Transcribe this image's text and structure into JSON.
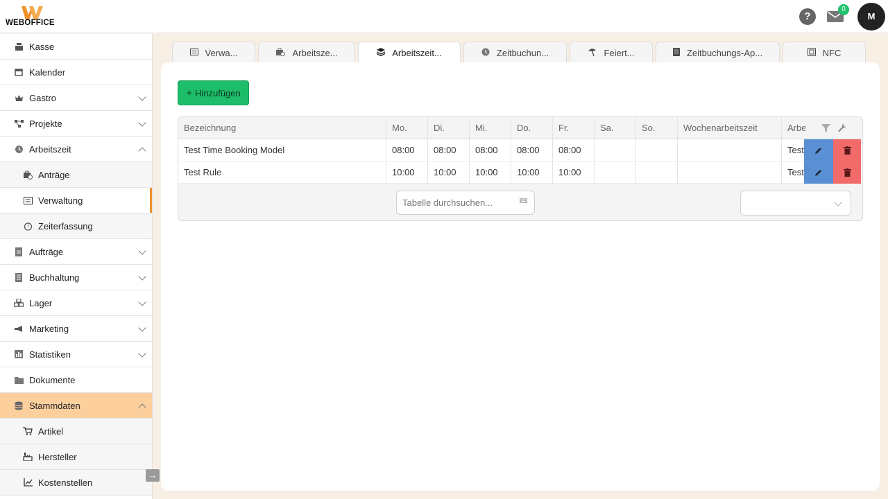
{
  "brand": {
    "name": "WEBOFFICE",
    "accent": "#f0922b",
    "logo_color": "#f0922b"
  },
  "header": {
    "help_symbol": "?",
    "mail_count": "0",
    "avatar_initial": "M"
  },
  "sidebar": {
    "items": [
      {
        "label": "Kasse",
        "icon": "cash-register-icon"
      },
      {
        "label": "Kalender",
        "icon": "calendar-icon"
      },
      {
        "label": "Gastro",
        "icon": "crown-icon",
        "expandable": true
      },
      {
        "label": "Projekte",
        "icon": "project-diagram-icon",
        "expandable": true
      },
      {
        "label": "Arbeitszeit",
        "icon": "clock-icon",
        "expanded": true
      },
      {
        "label": "Anträge",
        "icon": "briefcase-clock-icon",
        "sub": true
      },
      {
        "label": "Verwaltung",
        "icon": "list-icon",
        "sub": true,
        "active": true
      },
      {
        "label": "Zeiterfassung",
        "icon": "stopwatch-icon",
        "sub": true
      },
      {
        "label": "Aufträge",
        "icon": "file-icon",
        "expandable": true
      },
      {
        "label": "Buchhaltung",
        "icon": "ledger-icon",
        "expandable": true
      },
      {
        "label": "Lager",
        "icon": "boxes-icon",
        "expandable": true
      },
      {
        "label": "Marketing",
        "icon": "megaphone-icon",
        "expandable": true
      },
      {
        "label": "Statistiken",
        "icon": "chart-icon",
        "expandable": true
      },
      {
        "label": "Dokumente",
        "icon": "folder-icon"
      },
      {
        "label": "Stammdaten",
        "icon": "database-icon",
        "expanded": true,
        "highlighted": true
      },
      {
        "label": "Artikel",
        "icon": "cart-icon",
        "sub": true
      },
      {
        "label": "Hersteller",
        "icon": "factory-icon",
        "sub": true
      },
      {
        "label": "Kostenstellen",
        "icon": "cost-chart-icon",
        "sub": true
      }
    ],
    "collapse_symbol": "→"
  },
  "tabs": [
    {
      "label": "Verwa...",
      "icon": "list-icon"
    },
    {
      "label": "Arbeitsze...",
      "icon": "briefcase-clock-icon"
    },
    {
      "label": "Arbeitszeit...",
      "icon": "layers-icon",
      "active": true
    },
    {
      "label": "Zeitbuchun...",
      "icon": "clock-icon"
    },
    {
      "label": "Feiert...",
      "icon": "umbrella-beach-icon"
    },
    {
      "label": "Zeitbuchungs-Ap...",
      "icon": "tablet-icon"
    },
    {
      "label": "NFC",
      "icon": "nfc-icon"
    }
  ],
  "main": {
    "add_label": "Hinzufügen",
    "table": {
      "columns": [
        "Bezeichnung",
        "Mo.",
        "Di.",
        "Mi.",
        "Do.",
        "Fr.",
        "Sa.",
        "So.",
        "Wochenarbeitszeit",
        "Arbe"
      ],
      "rows": [
        [
          "Test Time Booking Model",
          "08:00",
          "08:00",
          "08:00",
          "08:00",
          "08:00",
          "",
          "",
          "",
          "Test"
        ],
        [
          "Test Rule",
          "10:00",
          "10:00",
          "10:00",
          "10:00",
          "10:00",
          "",
          "",
          "",
          "Test"
        ]
      ]
    },
    "search_placeholder": "Tabelle durchsuchen...",
    "page_size_value": ""
  }
}
